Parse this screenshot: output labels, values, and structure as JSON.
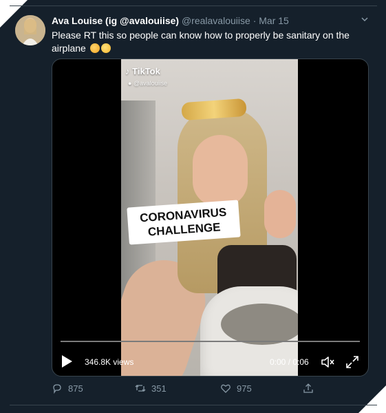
{
  "tweet": {
    "author_name": "Ava Louise (ig @avalouiise)",
    "handle": "@realavalouiise",
    "separator": "·",
    "date": "Mar 15",
    "text": "Please RT this so people can know how to properly be sanitary on the airplane"
  },
  "video": {
    "tiktok_logo": "TikTok",
    "tiktok_user": "@avalouiise",
    "caption_line_1": "CORONAVIRUS",
    "caption_line_2": "CHALLENGE",
    "views": "346.8K views",
    "time": "0:00 / 0:06",
    "progress": 0
  },
  "actions": {
    "replies": "875",
    "retweets": "351",
    "likes": "975"
  },
  "colors": {
    "background": "#15202b",
    "secondary_text": "#8899a6",
    "border": "#38444d"
  },
  "icons": [
    "chevron-down-icon",
    "play-icon",
    "volume-icon",
    "fullscreen-icon",
    "reply-icon",
    "retweet-icon",
    "like-icon",
    "share-icon",
    "tiktok-icon"
  ]
}
